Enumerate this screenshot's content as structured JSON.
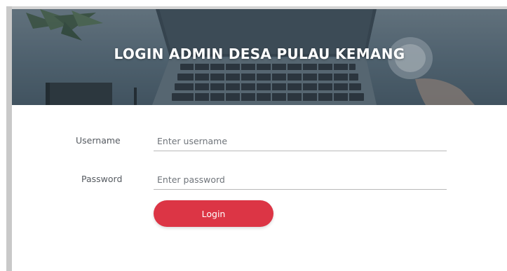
{
  "header": {
    "title": "LOGIN ADMIN DESA PULAU KEMANG"
  },
  "form": {
    "username_label": "Username",
    "username_placeholder": "Enter username",
    "username_value": "",
    "password_label": "Password",
    "password_placeholder": "Enter password",
    "password_value": "",
    "login_label": "Login"
  },
  "colors": {
    "accent": "#dc3545",
    "header_overlay": "#5f7280"
  },
  "icons": [
    "plant-decoration",
    "laptop-image",
    "notebook-image",
    "pen-image",
    "coffee-cup-image",
    "hand-image"
  ]
}
